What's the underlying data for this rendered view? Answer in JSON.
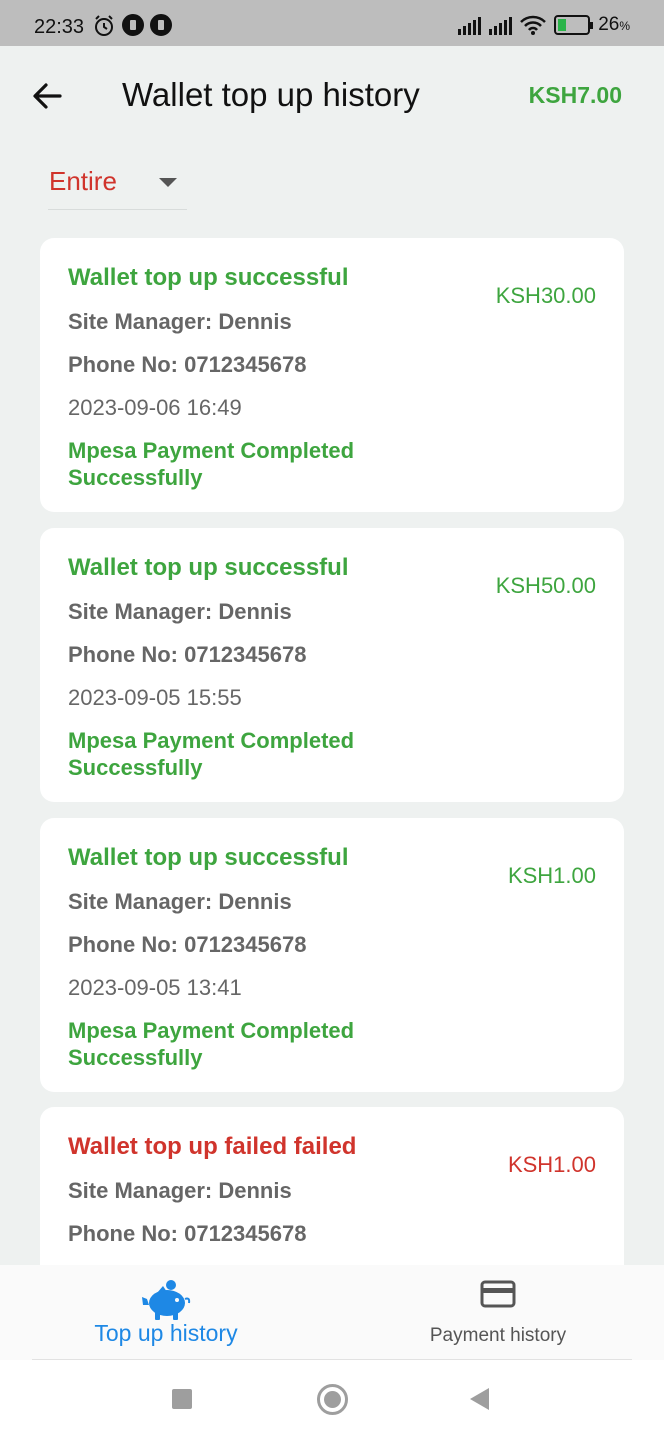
{
  "status_bar": {
    "time": "22:33",
    "battery": "26",
    "battery_suffix": "%",
    "icons": [
      "alarm-icon",
      "app-icon",
      "app-icon",
      "signal-icon",
      "signal-icon",
      "wifi-icon",
      "battery-icon"
    ]
  },
  "header": {
    "title": "Wallet top up history",
    "balance": "KSH7.00",
    "back_icon": "arrow-left-icon"
  },
  "filter": {
    "selected": "Entire"
  },
  "records": [
    {
      "title": "Wallet top up successful",
      "amount": "KSH30.00",
      "manager": "Site Manager: Dennis",
      "phone": "Phone No: 0712345678",
      "datetime": "2023-09-06 16:49",
      "status": "Mpesa Payment Completed Successfully"
    },
    {
      "title": "Wallet top up successful",
      "amount": "KSH50.00",
      "manager": "Site Manager: Dennis",
      "phone": "Phone No: 0712345678",
      "datetime": "2023-09-05 15:55",
      "status": "Mpesa Payment Completed Successfully"
    },
    {
      "title": "Wallet top up successful",
      "amount": "KSH1.00",
      "manager": "Site Manager: Dennis",
      "phone": "Phone No: 0712345678",
      "datetime": "2023-09-05 13:41",
      "status": "Mpesa Payment Completed Successfully"
    },
    {
      "title": "Wallet top up failed failed",
      "amount": "KSH1.00",
      "manager": "Site Manager: Dennis",
      "phone": "Phone No: 0712345678",
      "datetime": "",
      "status": ""
    }
  ],
  "bottom_nav": {
    "topup_label": "Top up history",
    "topup_icon": "piggy-bank-icon",
    "payment_label": "Payment history",
    "payment_icon": "credit-card-icon"
  },
  "colors": {
    "success": "#3ea53f",
    "failure": "#d0342c",
    "active_tab": "#1e88e5"
  }
}
